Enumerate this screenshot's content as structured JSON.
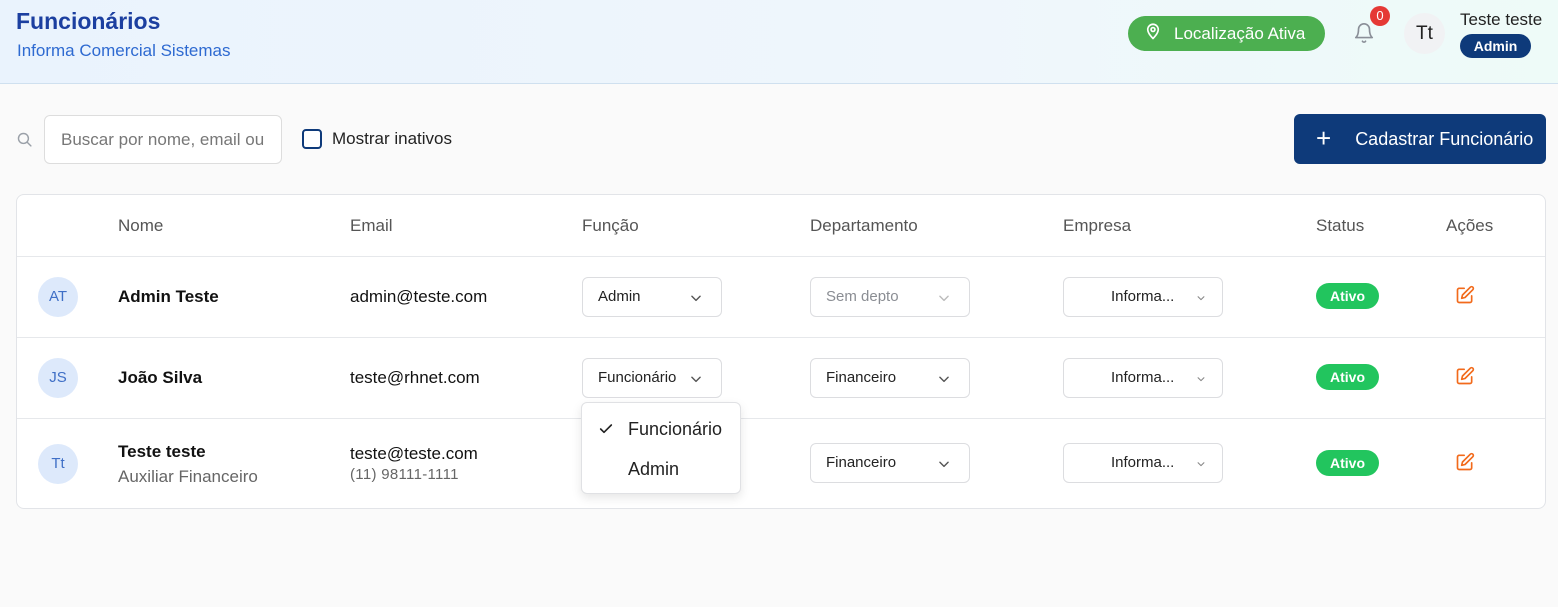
{
  "header": {
    "title": "Funcionários",
    "subtitle": "Informa Comercial Sistemas",
    "location_label": "Localização Ativa",
    "notifications_count": "0",
    "user_initials": "Tt",
    "user_name": "Teste teste",
    "user_role": "Admin"
  },
  "toolbar": {
    "search_placeholder": "Buscar por nome, email ou",
    "show_inactive_label": "Mostrar inativos",
    "show_inactive_checked": false,
    "add_button_label": "Cadastrar Funcionário"
  },
  "table": {
    "columns": [
      "Nome",
      "Email",
      "Função",
      "Departamento",
      "Empresa",
      "Status",
      "Ações"
    ],
    "rows": [
      {
        "initials": "AT",
        "name": "Admin Teste",
        "subtitle": "",
        "email": "admin@teste.com",
        "phone": "",
        "role": "Admin",
        "department": "Sem depto",
        "company": "Informa...",
        "status": "Ativo"
      },
      {
        "initials": "JS",
        "name": "João Silva",
        "subtitle": "",
        "email": "teste@rhnet.com",
        "phone": "",
        "role": "Funcionário",
        "department": "Financeiro",
        "company": "Informa...",
        "status": "Ativo"
      },
      {
        "initials": "Tt",
        "name": "Teste teste",
        "subtitle": "Auxiliar Financeiro",
        "email": "teste@teste.com",
        "phone": "(11) 98111-1111",
        "role": "Funcionário",
        "department": "Financeiro",
        "company": "Informa...",
        "status": "Ativo"
      }
    ]
  },
  "role_dropdown": {
    "options": [
      "Funcionário",
      "Admin"
    ],
    "selected": "Funcionário"
  },
  "colors": {
    "brand": "#0e3a7a",
    "title": "#1c3fa0",
    "location_pill": "#4caf50",
    "status_active": "#22c55e",
    "edit_icon": "#f26a1b",
    "notification_badge": "#e53935"
  }
}
